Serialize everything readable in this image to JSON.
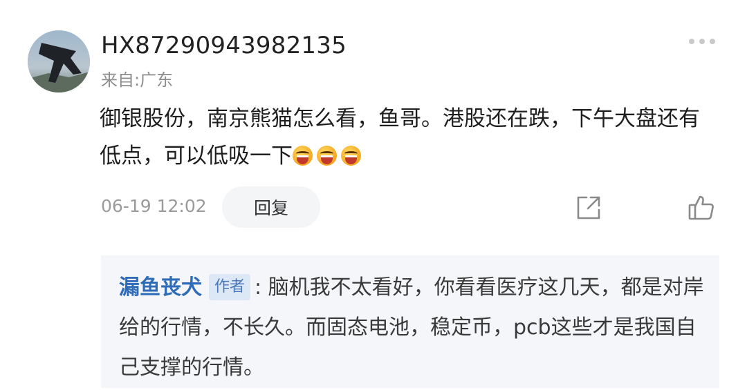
{
  "comment": {
    "username": "HX87290943982135",
    "location": "来自:广东",
    "text": "御银股份，南京熊猫怎么看，鱼哥。港股还在跌，下午大盘还有低点，可以低吸一下",
    "emojis": [
      "laughing-emoji",
      "laughing-emoji",
      "laughing-emoji"
    ],
    "time": "06-19 12:02",
    "reply_label": "回复",
    "icons": {
      "more": "more-dots-icon",
      "share": "share-icon",
      "like": "thumbs-up-icon"
    }
  },
  "reply": {
    "author": "漏鱼丧犬",
    "author_tag": "作者",
    "separator": ":",
    "text": " 脑机我不太看好，你看看医疗这几天，都是对岸给的行情，不长久。而固态电池，稳定币，pcb这些才是我国自己支撑的行情。"
  }
}
